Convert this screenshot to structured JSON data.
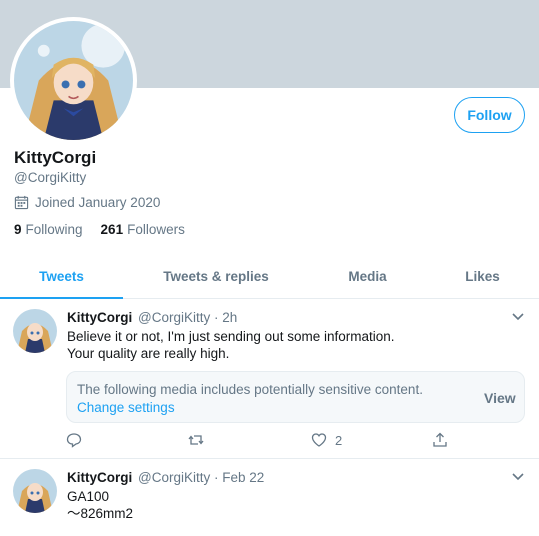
{
  "profile": {
    "name": "KittyCorgi",
    "handle": "@CorgiKitty",
    "joined": "Joined January 2020",
    "following_count": "9",
    "following_label": "Following",
    "followers_count": "261",
    "followers_label": "Followers",
    "follow_button": "Follow"
  },
  "tabs": [
    {
      "label": "Tweets",
      "active": true
    },
    {
      "label": "Tweets & replies",
      "active": false
    },
    {
      "label": "Media",
      "active": false
    },
    {
      "label": "Likes",
      "active": false
    }
  ],
  "tweets": [
    {
      "name": "KittyCorgi",
      "meta": "@CorgiKitty · 2h",
      "lines": [
        "Believe it or not, I'm just sending out some information.",
        "Your quality are really high."
      ],
      "sensitive": {
        "message": "The following media includes potentially sensitive content.",
        "change": "Change settings",
        "view": "View"
      },
      "actions": {
        "reply": "",
        "retweet": "",
        "like": "2"
      }
    },
    {
      "name": "KittyCorgi",
      "meta": "@CorgiKitty · Feb 22",
      "lines": [
        "GA100",
        "～826mm2"
      ]
    }
  ],
  "colors": {
    "accent": "#1da1f2",
    "banner": "#ccd6dd",
    "muted": "#657786",
    "text": "#14171a"
  },
  "icons": [
    "calendar-icon",
    "chevron-down-icon",
    "reply-icon",
    "retweet-icon",
    "like-icon",
    "share-icon"
  ]
}
